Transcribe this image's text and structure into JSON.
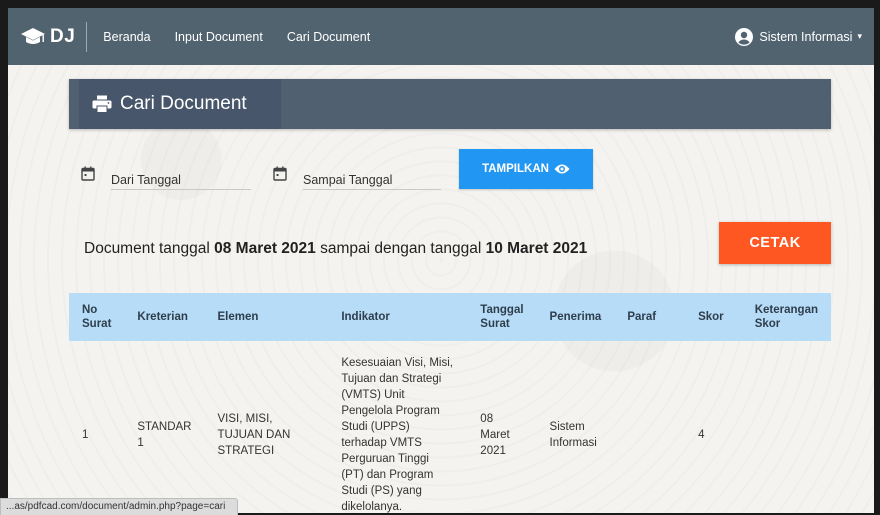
{
  "navbar": {
    "brand": "DJ",
    "items": [
      "Beranda",
      "Input Document",
      "Cari Document"
    ],
    "user": "Sistem Informasi"
  },
  "header": {
    "title": "Cari Document"
  },
  "filter": {
    "from_placeholder": "Dari Tanggal",
    "to_placeholder": "Sampai Tanggal",
    "show_button": "TAMPILKAN"
  },
  "summary": {
    "prefix": "Document tanggal ",
    "from_date": "08 Maret 2021",
    "middle": " sampai dengan tanggal ",
    "to_date": "10 Maret 2021"
  },
  "print_button": "CETAK",
  "table": {
    "headers": [
      "No Surat",
      "Kreterian",
      "Elemen",
      "Indikator",
      "Tanggal Surat",
      "Penerima",
      "Paraf",
      "Skor",
      "Keterangan Skor"
    ],
    "rows": [
      {
        "no": "1",
        "kreterian": "STANDAR 1",
        "elemen": "VISI, MISI, TUJUAN DAN STRATEGI",
        "indikator": "Kesesuaian Visi, Misi, Tujuan dan Strategi (VMTS) Unit Pengelola Program Studi (UPPS) terhadap VMTS Perguruan Tinggi (PT) dan Program Studi (PS) yang dikelolanya.",
        "tanggal": "08 Maret 2021",
        "penerima": "Sistem Informasi",
        "paraf": "",
        "skor": "4",
        "keterangan": ""
      }
    ]
  },
  "status_bar": "...as/pdfcad.com/document/admin.php?page=cari"
}
